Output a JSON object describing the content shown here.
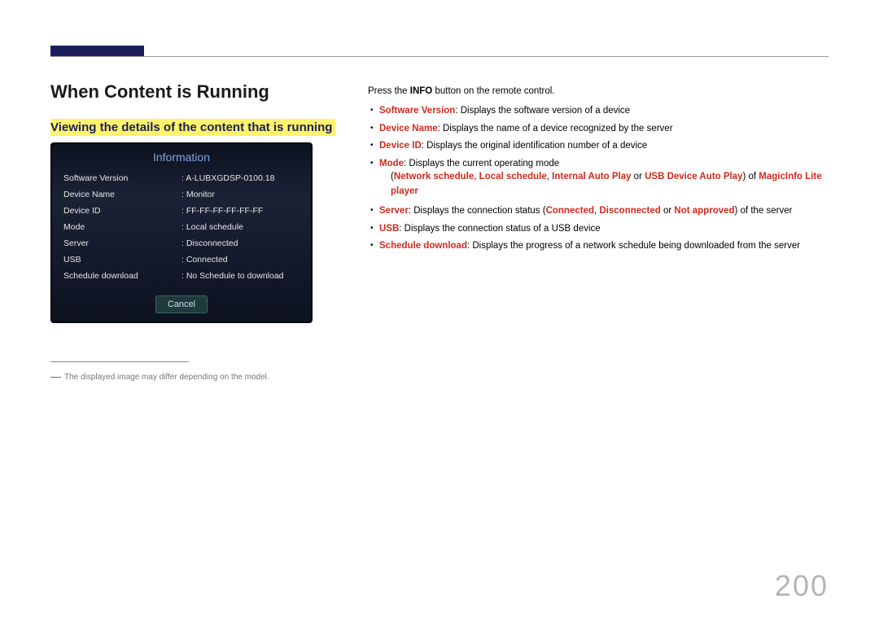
{
  "title": "When Content is Running",
  "subtitle": "Viewing the details of the content that is running",
  "panel": {
    "heading": "Information",
    "rows": [
      {
        "label": "Software Version",
        "value": "A-LUBXGDSP-0100.18"
      },
      {
        "label": "Device Name",
        "value": "Monitor"
      },
      {
        "label": "Device ID",
        "value": "FF-FF-FF-FF-FF-FF"
      },
      {
        "label": "Mode",
        "value": "Local schedule"
      },
      {
        "label": "Server",
        "value": "Disconnected"
      },
      {
        "label": "USB",
        "value": "Connected"
      },
      {
        "label": "Schedule download",
        "value": "No Schedule to download"
      }
    ],
    "cancel": "Cancel"
  },
  "note": "The displayed image may differ depending on the model.",
  "right": {
    "intro_a": "Press the ",
    "intro_b": "INFO",
    "intro_c": " button on the remote control.",
    "b1_t": "Software Version",
    "b1_r": ": Displays the software version of a device",
    "b2_t": "Device Name",
    "b2_r": ": Displays the name of a device recognized by the server",
    "b3_t": "Device ID",
    "b3_r": ": Displays the original identification number of a device",
    "b4_t": "Mode",
    "b4_r": ": Displays the current operating mode",
    "b4_sub_a": "(",
    "b4_sub_b": "Network schedule",
    "b4_sub_c": ", ",
    "b4_sub_d": "Local schedule",
    "b4_sub_e": ", ",
    "b4_sub_f": "Internal Auto Play",
    "b4_sub_g": " or ",
    "b4_sub_h": "USB Device Auto Play",
    "b4_sub_i": ") of ",
    "b4_sub_j": "MagicInfo Lite player",
    "b5_t": "Server",
    "b5_a": ": Displays the connection status (",
    "b5_b": "Connected",
    "b5_c": ", ",
    "b5_d": "Disconnected",
    "b5_e": " or ",
    "b5_f": "Not approved",
    "b5_g": ") of the server",
    "b6_t": "USB",
    "b6_r": ": Displays the connection status of a USB device",
    "b7_t": "Schedule download",
    "b7_r": ": Displays the progress of a network schedule being downloaded from the server"
  },
  "page_number": "200"
}
